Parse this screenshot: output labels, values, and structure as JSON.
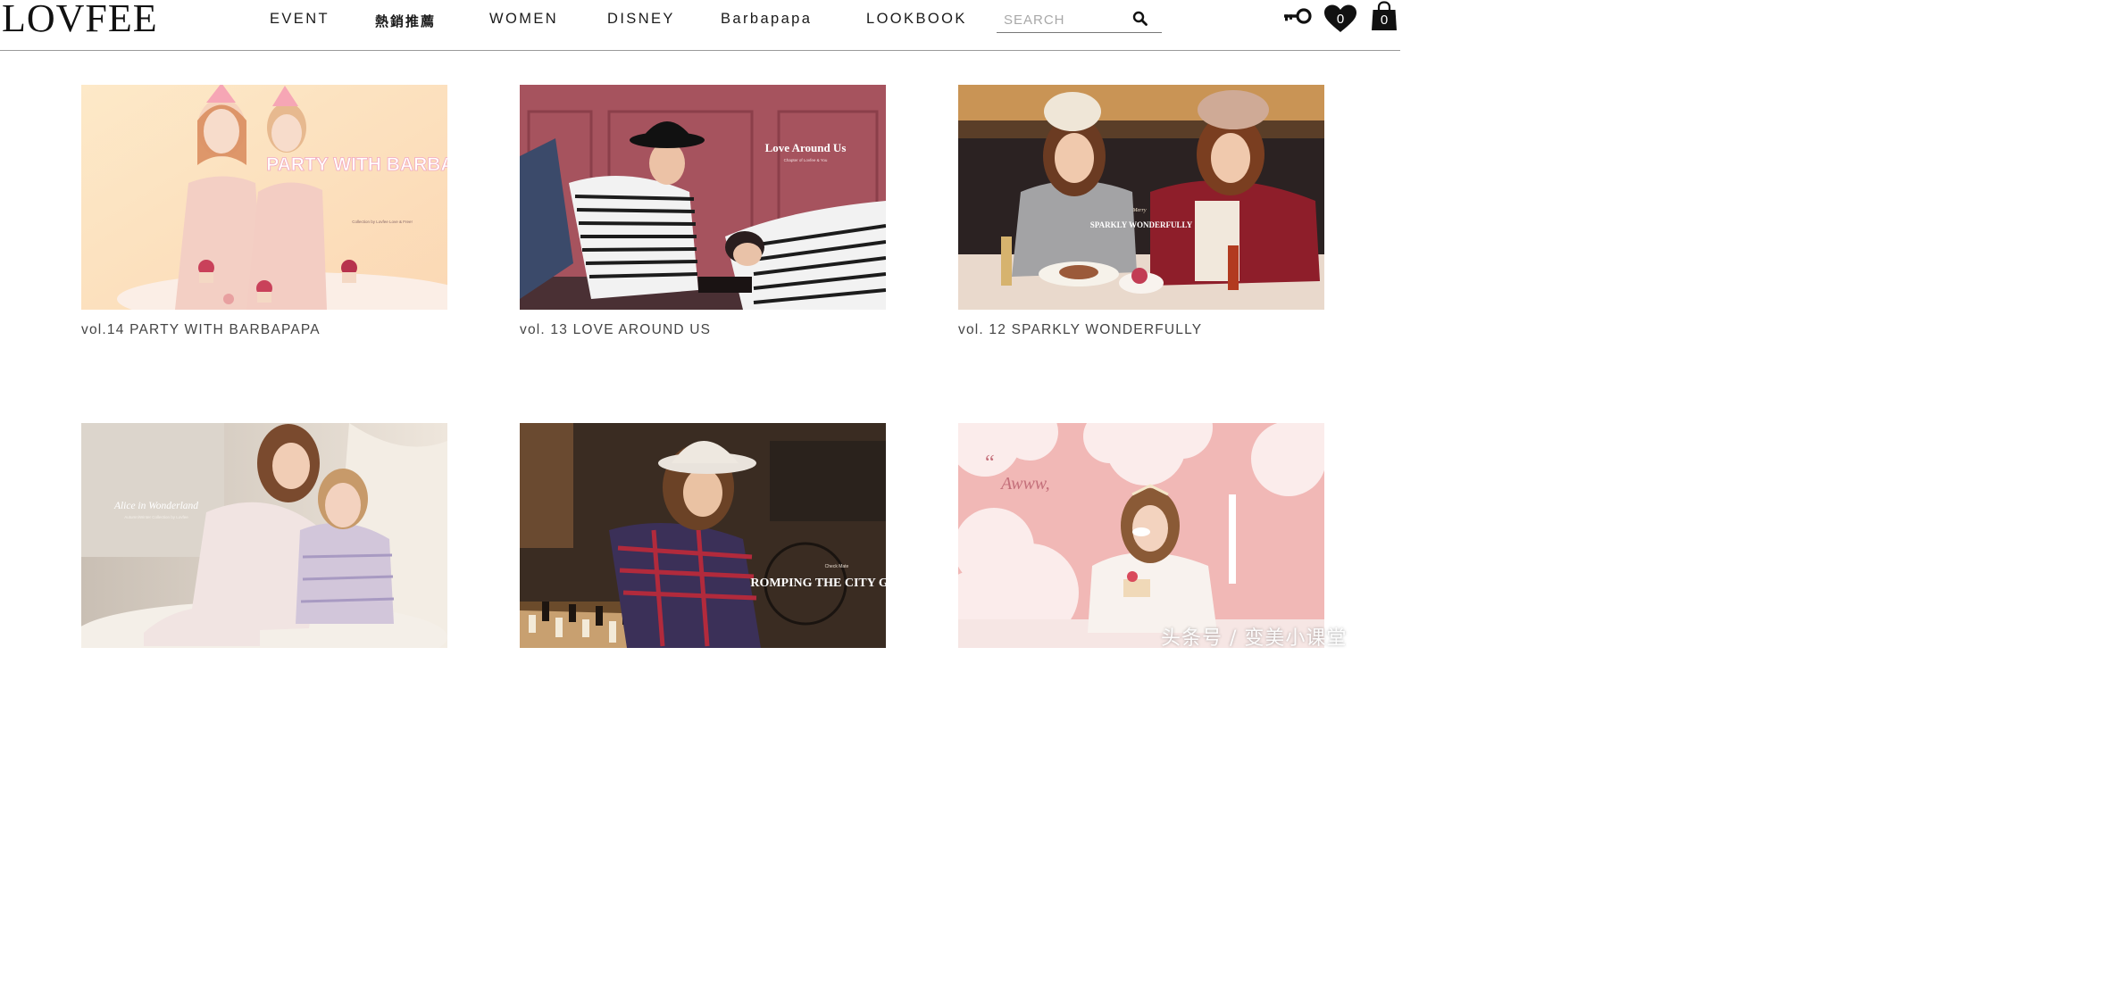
{
  "header": {
    "logo": "LOVFEE",
    "nav": [
      {
        "label": "EVENT"
      },
      {
        "label": "熱銷推薦"
      },
      {
        "label": "WOMEN"
      },
      {
        "label": "DISNEY"
      },
      {
        "label": "Barbapapa"
      },
      {
        "label": "LOOKBOOK"
      }
    ],
    "search": {
      "placeholder": "SEARCH",
      "value": ""
    },
    "wishlist_count": "0",
    "cart_count": "0"
  },
  "lookbooks": [
    {
      "caption": "vol.14 PARTY WITH BARBAPAPA",
      "overlay_title": "PARTY WITH BARBAPAPA",
      "overlay_sub": "Collection by Lovfee Love & Free!"
    },
    {
      "caption": "vol. 13 LOVE AROUND US",
      "overlay_title": "Love Around Us",
      "overlay_sub": "Chapter of Lovfee & You"
    },
    {
      "caption": "vol. 12 SPARKLY WONDERFULLY",
      "overlay_title": "SPARKLY WONDERFULLY",
      "overlay_sub": "Merry"
    },
    {
      "caption": "",
      "overlay_title": "Alice in Wonderland",
      "overlay_sub": "Autumn/Winter Collection by Lovfee"
    },
    {
      "caption": "",
      "overlay_title": "ROMPING THE CITY GIRL",
      "overlay_sub": "Check Mate"
    },
    {
      "caption": "",
      "overlay_title": "Awww,",
      "overlay_sub": "“"
    }
  ],
  "watermark": "头条号 / 变美小课堂",
  "colors": {
    "text": "#222222",
    "caption": "#444444",
    "divider": "#9a9a9a"
  }
}
